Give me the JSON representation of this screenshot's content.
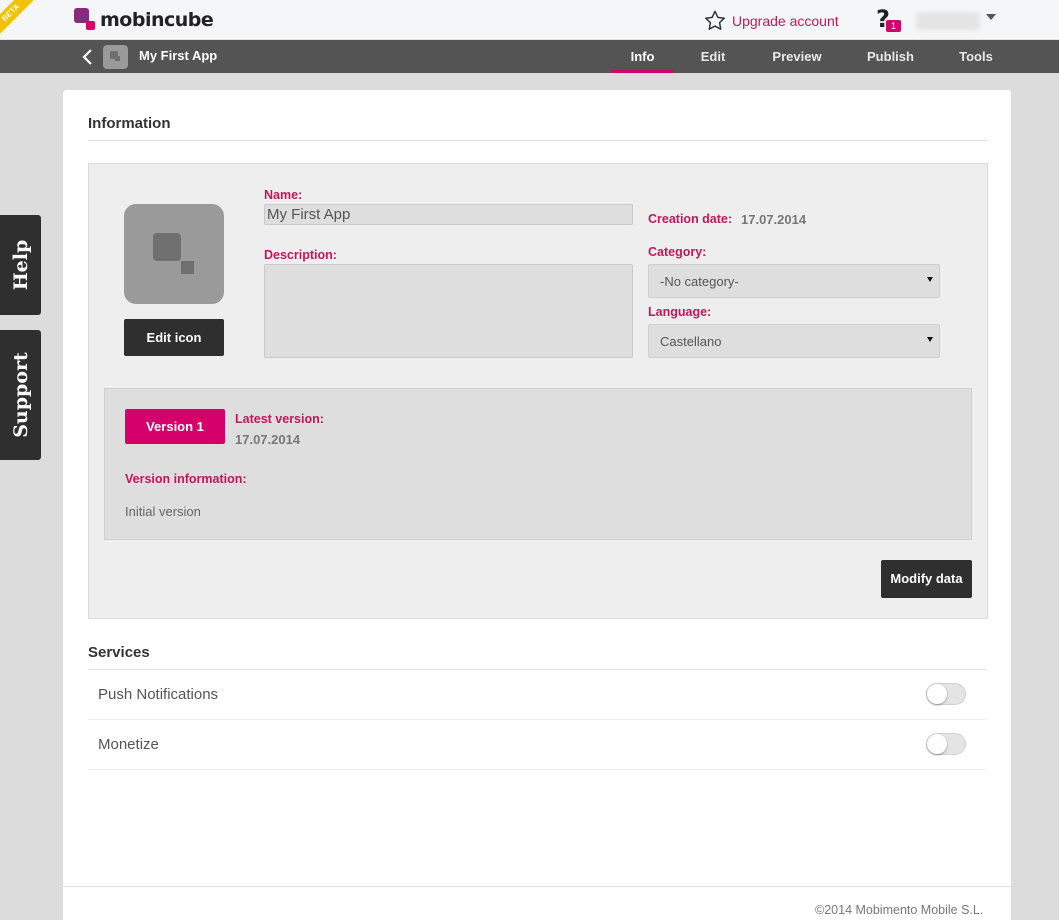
{
  "header": {
    "beta_label": "BETA",
    "logo_text": "mobincube",
    "upgrade_label": "Upgrade account",
    "help_symbol": "?",
    "notification_count": "1",
    "icons": [
      "star-icon",
      "help-icon",
      "chevron-down-icon"
    ]
  },
  "appbar": {
    "app_title": "My First App",
    "tabs": [
      {
        "label": "Info",
        "active": true
      },
      {
        "label": "Edit",
        "active": false
      },
      {
        "label": "Preview",
        "active": false
      },
      {
        "label": "Publish",
        "active": false
      },
      {
        "label": "Tools",
        "active": false
      }
    ]
  },
  "side_tabs": {
    "help": "Help",
    "support": "Support"
  },
  "information": {
    "section_title": "Information",
    "edit_icon_label": "Edit icon",
    "name_label": "Name:",
    "name_value": "My First App",
    "description_label": "Description:",
    "description_value": "",
    "creation_date_label": "Creation date:",
    "creation_date_value": "17.07.2014",
    "category_label": "Category:",
    "category_value": "-No category-",
    "language_label": "Language:",
    "language_value": "Castellano",
    "version_button": "Version 1",
    "latest_version_label": "Latest version:",
    "latest_version_value": "17.07.2014",
    "version_info_label": "Version information:",
    "version_info_value": "Initial version",
    "modify_label": "Modify data"
  },
  "services": {
    "section_title": "Services",
    "items": [
      {
        "label": "Push Notifications",
        "enabled": false
      },
      {
        "label": "Monetize",
        "enabled": false
      }
    ]
  },
  "footer": {
    "copyright": "©2014 Mobimento Mobile S.L."
  },
  "colors": {
    "accent": "#d6006c",
    "label_accent": "#c2185b",
    "dark_button": "#2f2f2f",
    "nav_bar": "#545454"
  }
}
